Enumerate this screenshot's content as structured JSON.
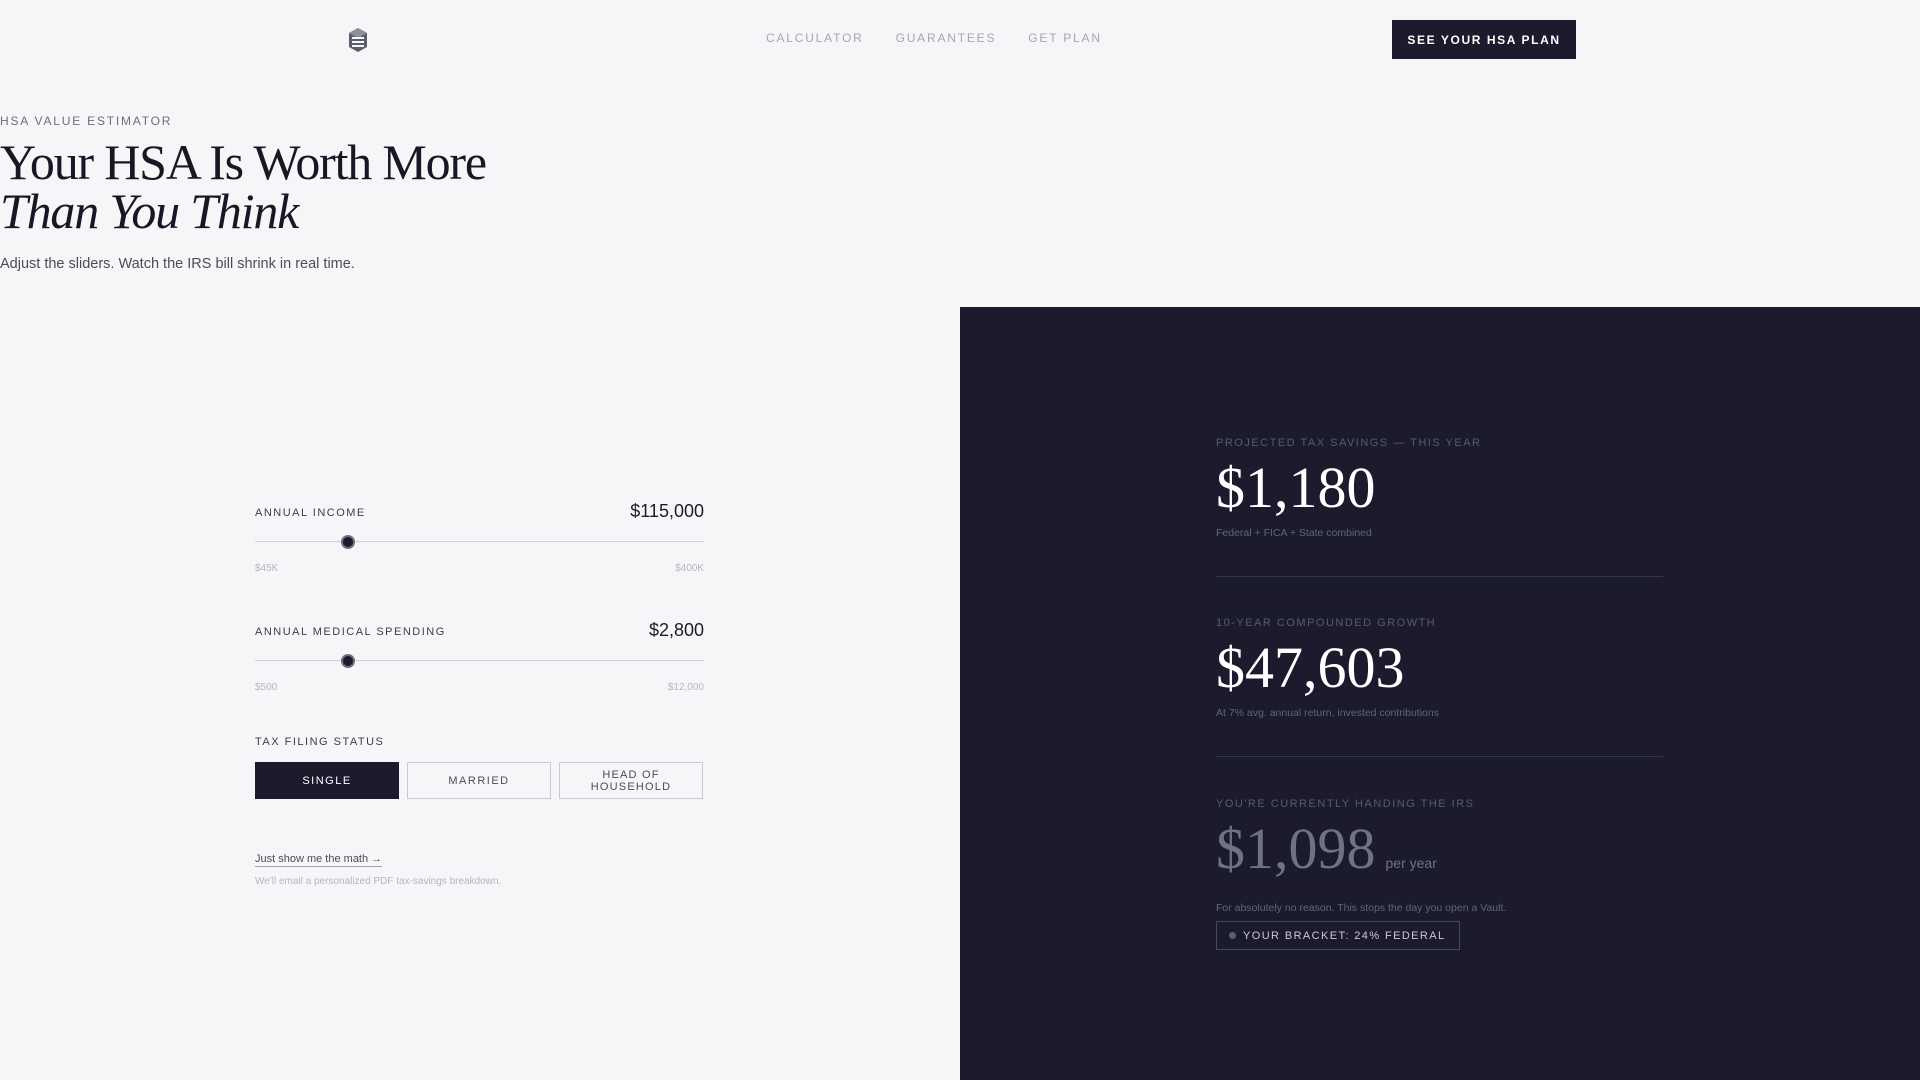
{
  "nav": {
    "links": [
      "CALCULATOR",
      "GUARANTEES",
      "GET PLAN"
    ],
    "cta_label": "SEE YOUR HSA PLAN"
  },
  "hero": {
    "eyebrow": "HSA VALUE ESTIMATOR",
    "title_line1": "Your HSA Is Worth More",
    "title_line2": "Than You Think",
    "subtitle": "Adjust the sliders. Watch the IRS bill shrink in real time."
  },
  "inputs": {
    "income": {
      "label": "ANNUAL INCOME",
      "value": "$115,000",
      "min_label": "$45K",
      "max_label": "$400K",
      "fraction": 0.207
    },
    "medical": {
      "label": "ANNUAL MEDICAL SPENDING",
      "value": "$2,800",
      "min_label": "$500",
      "max_label": "$12,000",
      "fraction": 0.207
    },
    "filing": {
      "label": "TAX FILING STATUS",
      "options": [
        "SINGLE",
        "MARRIED",
        "HEAD OF HOUSEHOLD"
      ],
      "selected": "SINGLE"
    },
    "math_link": "Just show me the math →",
    "math_note": "We'll email a personalized PDF tax-savings breakdown."
  },
  "results": {
    "savings": {
      "label": "PROJECTED TAX SAVINGS — THIS YEAR",
      "value": "$1,180",
      "note": "Federal + FICA + State combined"
    },
    "growth": {
      "label": "10-YEAR COMPOUNDED GROWTH",
      "value": "$47,603",
      "note": "At 7% avg. annual return, invested contributions"
    },
    "irs": {
      "label": "YOU'RE CURRENTLY HANDING THE IRS",
      "value": "$1,098",
      "suffix": "per year",
      "note": "For absolutely no reason. This stops the day you open a Vault."
    },
    "bracket": "YOUR BRACKET: 24% FEDERAL"
  },
  "colors": {
    "background": "#f6f6f8",
    "dark_panel": "#1b1b2d",
    "accent_dark": "#1b1b2d"
  }
}
